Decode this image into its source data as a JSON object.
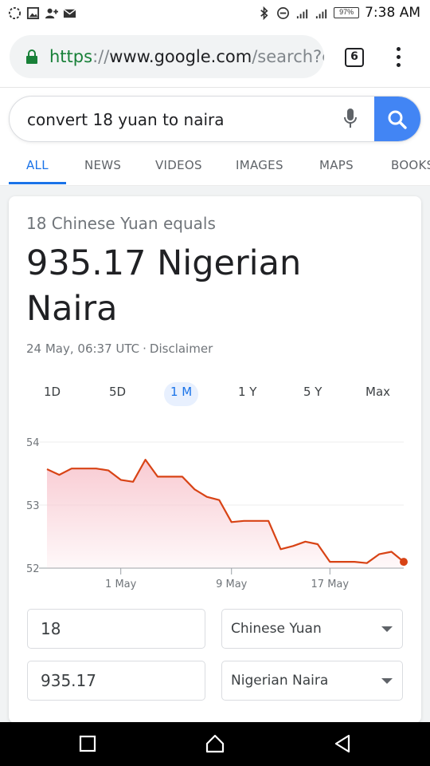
{
  "status_bar": {
    "time": "7:38 AM",
    "battery": "97%",
    "icons": [
      "circle-dashed-icon",
      "image-icon",
      "add-person-icon",
      "mail-icon",
      "bluetooth-icon",
      "do-not-disturb-icon",
      "signal-icon",
      "signal-icon"
    ]
  },
  "browser": {
    "url_scheme": "https",
    "url_separator": "://",
    "url_host": "www.google.com",
    "url_path": "/search?c",
    "tab_count": "6"
  },
  "search": {
    "query": "convert 18 yuan to naira"
  },
  "tabs": [
    "ALL",
    "NEWS",
    "VIDEOS",
    "IMAGES",
    "MAPS",
    "BOOKS"
  ],
  "result": {
    "equals_label": "18 Chinese Yuan equals",
    "amount": "935.17 Nigerian Naira",
    "timestamp": "24 May, 06:37 UTC",
    "separator": "·",
    "disclaimer": "Disclaimer"
  },
  "ranges": [
    "1D",
    "5D",
    "1 M",
    "1 Y",
    "5 Y",
    "Max"
  ],
  "selected_range": "1 M",
  "chart_data": {
    "type": "area",
    "x_ticks": [
      "1 May",
      "9 May",
      "17 May"
    ],
    "y_ticks": [
      "54",
      "53",
      "52"
    ],
    "ylim": [
      52,
      54
    ],
    "grid": true,
    "line_color": "#d84315",
    "fill_color": "#f8c8d0",
    "series": [
      {
        "values": [
          53.57,
          53.48,
          53.58,
          53.58,
          53.58,
          53.55,
          53.4,
          53.37,
          53.72,
          53.45,
          53.45,
          53.45,
          53.25,
          53.13,
          53.08,
          52.73,
          52.75,
          52.75,
          52.75,
          52.3,
          52.35,
          52.42,
          52.38,
          52.1,
          52.1,
          52.1,
          52.08,
          52.22,
          52.26,
          52.1
        ]
      }
    ]
  },
  "converter": {
    "from_amount": "18",
    "from_currency": "Chinese Yuan",
    "to_amount": "935.17",
    "to_currency": "Nigerian Naira"
  },
  "colors": {
    "accent": "#1a73e8",
    "search_button": "#4285f4",
    "lock": "#188038",
    "chart_line": "#d84315"
  }
}
